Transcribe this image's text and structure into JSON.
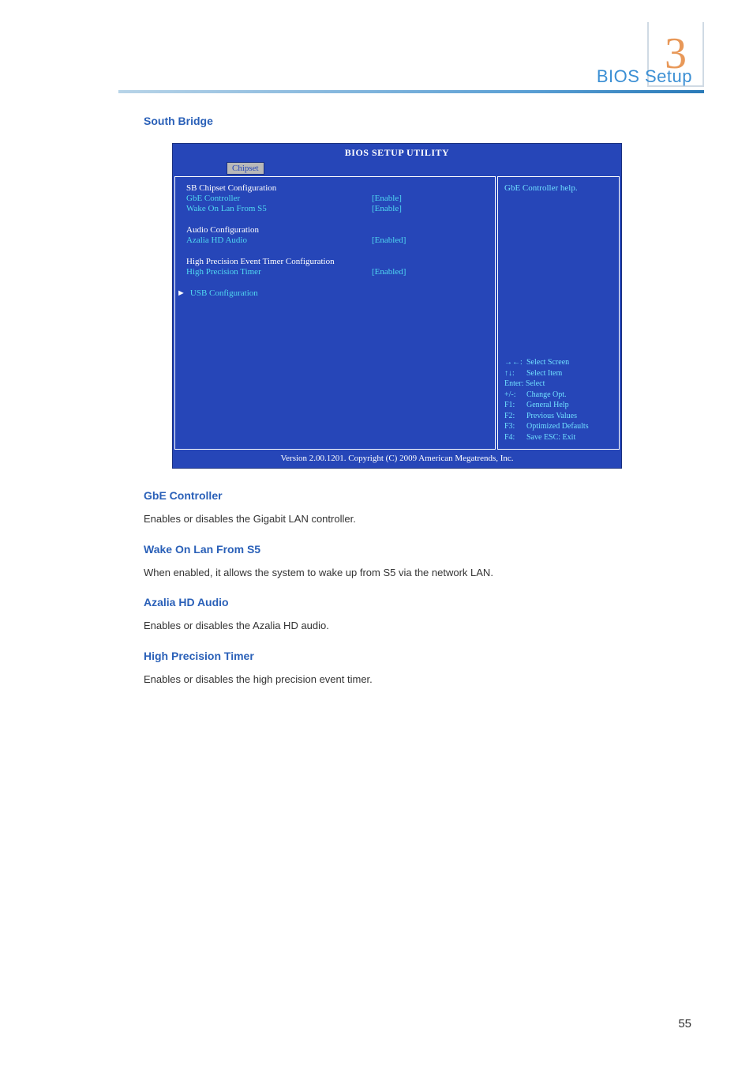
{
  "header": {
    "breadcrumb": "BIOS Setup",
    "chapter": "3"
  },
  "section_title": "South Bridge",
  "bios": {
    "title": "BIOS SETUP UTILITY",
    "tab": "Chipset",
    "groups": {
      "sb_header": "SB Chipset Configuration",
      "gbe_label": "GbE Controller",
      "gbe_value": "[Enable]",
      "wol_label": "Wake On Lan From S5",
      "wol_value": "[Enable]",
      "audio_header": "Audio Configuration",
      "azalia_label": "Azalia HD Audio",
      "azalia_value": "[Enabled]",
      "hpet_header": "High Precision Event Timer Configuration",
      "hpet_label": "High Precision Timer",
      "hpet_value": "[Enabled]",
      "usb_label": "USB Configuration"
    },
    "help_text": "GbE Controller help.",
    "keys": {
      "select_screen": "Select Screen",
      "select_item": "Select Item",
      "enter": "Enter: Select",
      "change": "Change Opt.",
      "general": "General Help",
      "previous": "Previous Values",
      "optimized": "Optimized Defaults",
      "save": "Save   ESC: Exit"
    },
    "footer": "Version 2.00.1201. Copyright (C) 2009 American Megatrends, Inc."
  },
  "sections": {
    "gbe": {
      "title": "GbE Controller",
      "text": "Enables or disables the Gigabit LAN controller."
    },
    "wol": {
      "title": "Wake On Lan From S5",
      "text": "When enabled, it allows the system to wake up from S5 via the network LAN."
    },
    "azalia": {
      "title": "Azalia HD Audio",
      "text": "Enables or disables the Azalia HD audio."
    },
    "hpet": {
      "title": "High Precision Timer",
      "text": "Enables or disables the high precision event timer."
    }
  },
  "page_number": "55"
}
